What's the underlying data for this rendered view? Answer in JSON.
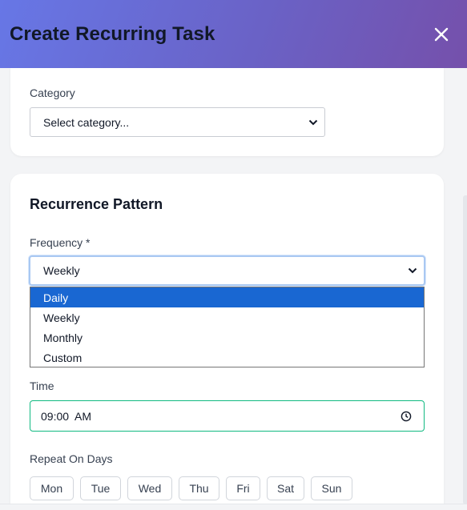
{
  "header": {
    "title": "Create Recurring Task",
    "close_icon": "close-icon"
  },
  "category": {
    "label": "Category",
    "value": "Select category..."
  },
  "recurrence": {
    "title": "Recurrence Pattern",
    "frequency_label": "Frequency *",
    "frequency_value": "Weekly",
    "options": [
      "Daily",
      "Weekly",
      "Monthly",
      "Custom"
    ],
    "highlighted_option": "Daily"
  },
  "time": {
    "label": "Time",
    "value": "09:00  AM",
    "icon": "clock-icon"
  },
  "repeat_days": {
    "label": "Repeat On Days",
    "days": [
      "Mon",
      "Tue",
      "Wed",
      "Thu",
      "Fri",
      "Sat",
      "Sun"
    ]
  },
  "colors": {
    "header_gradient_start": "#6777e6",
    "header_gradient_end": "#7550ab",
    "time_border": "#10b981",
    "highlight": "#1967d2"
  }
}
